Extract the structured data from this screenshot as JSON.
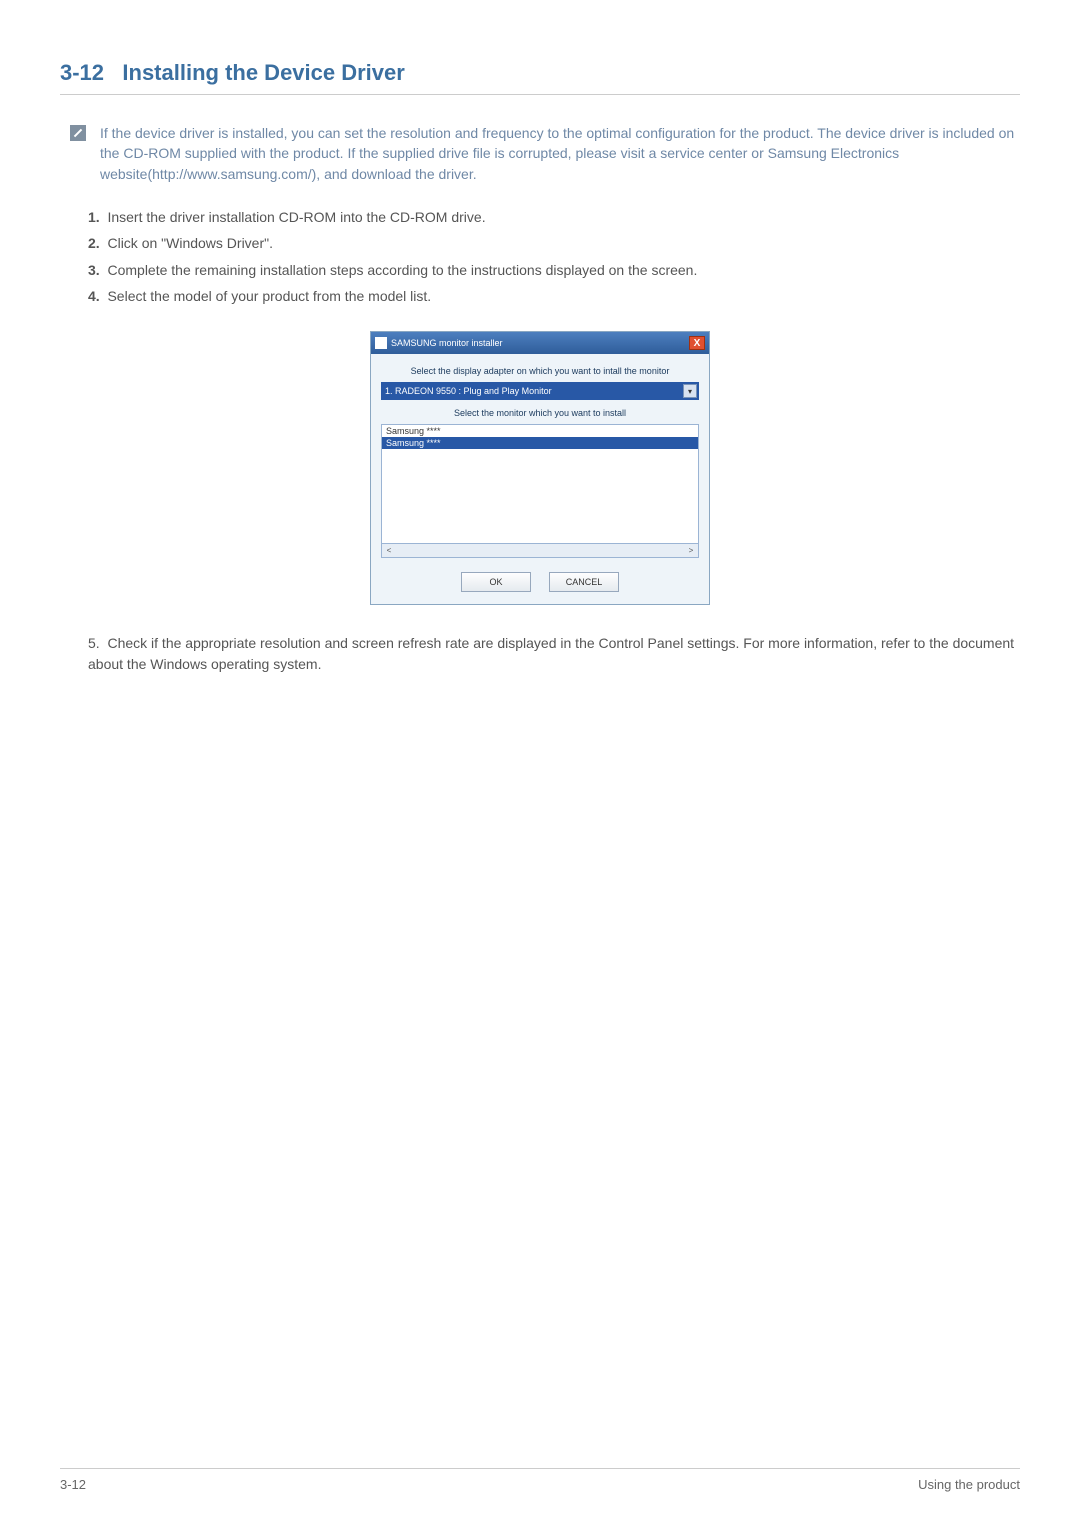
{
  "heading": {
    "number": "3-12",
    "title": "Installing the Device Driver"
  },
  "note": {
    "text": "If the device driver is installed, you can set the resolution and frequency to the optimal configuration for the product. The device driver is included on the CD-ROM supplied with the product. If the supplied drive file is corrupted, please visit a service center or Samsung Electronics website(http://www.samsung.com/), and download the driver."
  },
  "steps": [
    "Insert the driver installation CD-ROM into the CD-ROM drive.",
    "Click on \"Windows Driver\".",
    "Complete the remaining installation steps according to the instructions displayed on the screen.",
    "Select the model of your product from the model list."
  ],
  "dialog": {
    "title": "SAMSUNG monitor installer",
    "close": "X",
    "label_adapter": "Select the display adapter on which you want to intall the monitor",
    "combo_value": "1. RADEON 9550 : Plug and Play Monitor",
    "label_monitor": "Select the monitor which you want to install",
    "list_items": [
      "Samsung ****",
      "Samsung ****"
    ],
    "scroll_left": "<",
    "scroll_right": ">",
    "btn_ok": "OK",
    "btn_cancel": "CANCEL"
  },
  "steps_after": [
    "Check if the appropriate resolution and screen refresh rate are displayed in the Control Panel settings. For more information, refer to the document about the Windows operating system."
  ],
  "footer": {
    "left": "3-12",
    "right": "Using the product"
  }
}
